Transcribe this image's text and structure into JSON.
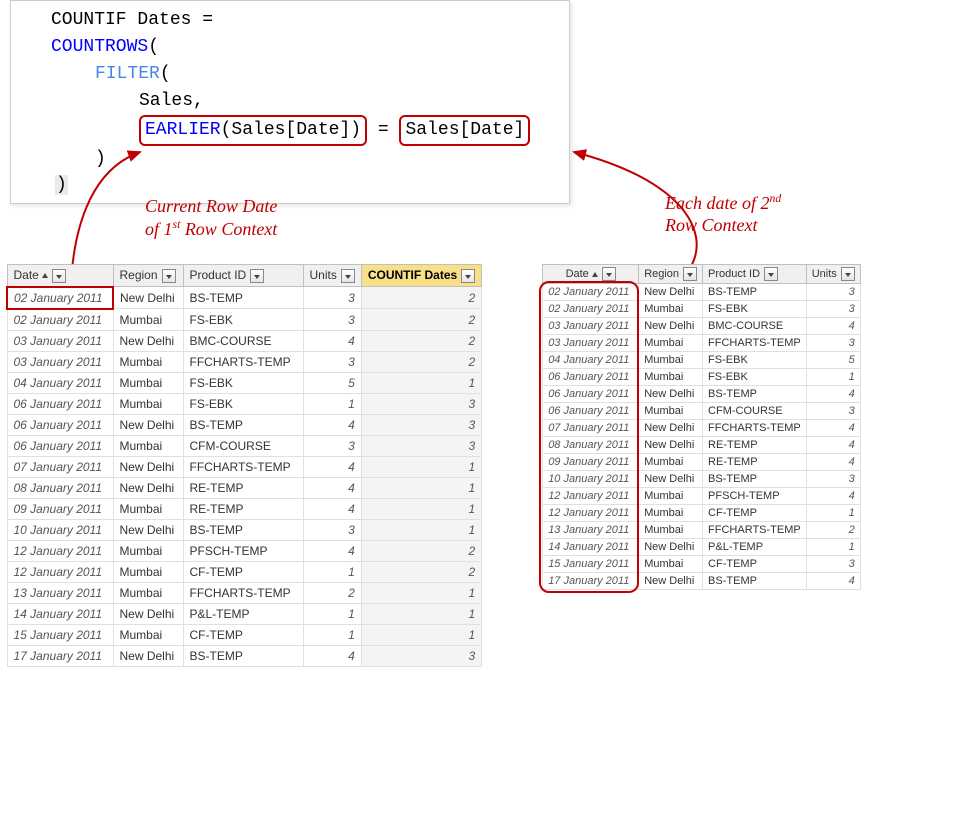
{
  "formula": {
    "line1_name": "COUNTIF Dates =",
    "fn_countrows": "COUNTROWS",
    "open_paren": "(",
    "fn_filter": "FILTER",
    "filter_open": "(",
    "arg_sales": "Sales,",
    "fn_earlier": "EARLIER",
    "earlier_arg": "(Sales[Date])",
    "equals": " = ",
    "rhs": "Sales[Date]",
    "close_paren": ")",
    "close_paren2": ")"
  },
  "annotations": {
    "left_l1": "Current Row Date",
    "left_l2": "of 1",
    "left_sup": "st",
    "left_l2b": "  Row Context",
    "right_l1": "Each date of 2",
    "right_sup": "nd",
    "right_l2": "Row Context"
  },
  "left_table": {
    "headers": [
      "Date",
      "Region",
      "Product ID",
      "Units",
      "COUNTIF Dates"
    ],
    "rows": [
      {
        "date": "02 January 2011",
        "region": "New Delhi",
        "prod": "BS-TEMP",
        "units": 3,
        "cif": 2
      },
      {
        "date": "02 January 2011",
        "region": "Mumbai",
        "prod": "FS-EBK",
        "units": 3,
        "cif": 2
      },
      {
        "date": "03 January 2011",
        "region": "New Delhi",
        "prod": "BMC-COURSE",
        "units": 4,
        "cif": 2
      },
      {
        "date": "03 January 2011",
        "region": "Mumbai",
        "prod": "FFCHARTS-TEMP",
        "units": 3,
        "cif": 2
      },
      {
        "date": "04 January 2011",
        "region": "Mumbai",
        "prod": "FS-EBK",
        "units": 5,
        "cif": 1
      },
      {
        "date": "06 January 2011",
        "region": "Mumbai",
        "prod": "FS-EBK",
        "units": 1,
        "cif": 3
      },
      {
        "date": "06 January 2011",
        "region": "New Delhi",
        "prod": "BS-TEMP",
        "units": 4,
        "cif": 3
      },
      {
        "date": "06 January 2011",
        "region": "Mumbai",
        "prod": "CFM-COURSE",
        "units": 3,
        "cif": 3
      },
      {
        "date": "07 January 2011",
        "region": "New Delhi",
        "prod": "FFCHARTS-TEMP",
        "units": 4,
        "cif": 1
      },
      {
        "date": "08 January 2011",
        "region": "New Delhi",
        "prod": "RE-TEMP",
        "units": 4,
        "cif": 1
      },
      {
        "date": "09 January 2011",
        "region": "Mumbai",
        "prod": "RE-TEMP",
        "units": 4,
        "cif": 1
      },
      {
        "date": "10 January 2011",
        "region": "New Delhi",
        "prod": "BS-TEMP",
        "units": 3,
        "cif": 1
      },
      {
        "date": "12 January 2011",
        "region": "Mumbai",
        "prod": "PFSCH-TEMP",
        "units": 4,
        "cif": 2
      },
      {
        "date": "12 January 2011",
        "region": "Mumbai",
        "prod": "CF-TEMP",
        "units": 1,
        "cif": 2
      },
      {
        "date": "13 January 2011",
        "region": "Mumbai",
        "prod": "FFCHARTS-TEMP",
        "units": 2,
        "cif": 1
      },
      {
        "date": "14 January 2011",
        "region": "New Delhi",
        "prod": "P&L-TEMP",
        "units": 1,
        "cif": 1
      },
      {
        "date": "15 January 2011",
        "region": "Mumbai",
        "prod": "CF-TEMP",
        "units": 1,
        "cif": 1
      },
      {
        "date": "17 January 2011",
        "region": "New Delhi",
        "prod": "BS-TEMP",
        "units": 4,
        "cif": 3
      }
    ]
  },
  "right_table": {
    "headers": [
      "Date",
      "Region",
      "Product ID",
      "Units"
    ],
    "rows": [
      {
        "date": "02 January 2011",
        "region": "New Delhi",
        "prod": "BS-TEMP",
        "units": 3
      },
      {
        "date": "02 January 2011",
        "region": "Mumbai",
        "prod": "FS-EBK",
        "units": 3
      },
      {
        "date": "03 January 2011",
        "region": "New Delhi",
        "prod": "BMC-COURSE",
        "units": 4
      },
      {
        "date": "03 January 2011",
        "region": "Mumbai",
        "prod": "FFCHARTS-TEMP",
        "units": 3
      },
      {
        "date": "04 January 2011",
        "region": "Mumbai",
        "prod": "FS-EBK",
        "units": 5
      },
      {
        "date": "06 January 2011",
        "region": "Mumbai",
        "prod": "FS-EBK",
        "units": 1
      },
      {
        "date": "06 January 2011",
        "region": "New Delhi",
        "prod": "BS-TEMP",
        "units": 4
      },
      {
        "date": "06 January 2011",
        "region": "Mumbai",
        "prod": "CFM-COURSE",
        "units": 3
      },
      {
        "date": "07 January 2011",
        "region": "New Delhi",
        "prod": "FFCHARTS-TEMP",
        "units": 4
      },
      {
        "date": "08 January 2011",
        "region": "New Delhi",
        "prod": "RE-TEMP",
        "units": 4
      },
      {
        "date": "09 January 2011",
        "region": "Mumbai",
        "prod": "RE-TEMP",
        "units": 4
      },
      {
        "date": "10 January 2011",
        "region": "New Delhi",
        "prod": "BS-TEMP",
        "units": 3
      },
      {
        "date": "12 January 2011",
        "region": "Mumbai",
        "prod": "PFSCH-TEMP",
        "units": 4
      },
      {
        "date": "12 January 2011",
        "region": "Mumbai",
        "prod": "CF-TEMP",
        "units": 1
      },
      {
        "date": "13 January 2011",
        "region": "Mumbai",
        "prod": "FFCHARTS-TEMP",
        "units": 2
      },
      {
        "date": "14 January 2011",
        "region": "New Delhi",
        "prod": "P&L-TEMP",
        "units": 1
      },
      {
        "date": "15 January 2011",
        "region": "Mumbai",
        "prod": "CF-TEMP",
        "units": 3
      },
      {
        "date": "17 January 2011",
        "region": "New Delhi",
        "prod": "BS-TEMP",
        "units": 4
      }
    ]
  }
}
